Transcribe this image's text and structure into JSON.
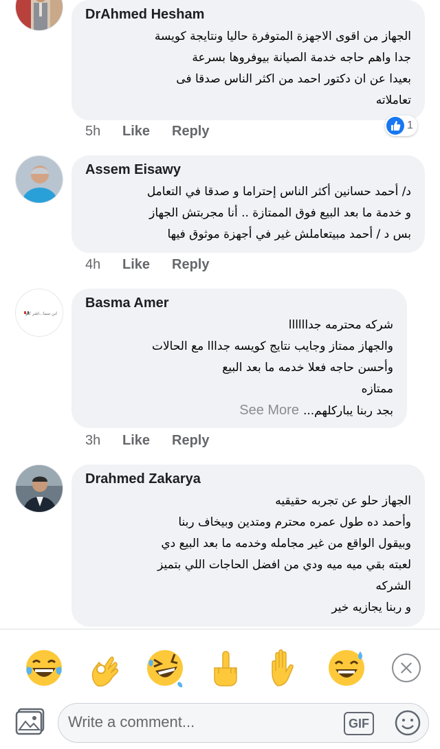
{
  "comments": [
    {
      "author": "DrAhmed Hesham",
      "lines": [
        "الجهاز من اقوى الاجهزة المتوفرة حاليا ونتايجة كويسة",
        "جدا  واهم حاجه خدمة الصيانة بيوفروها بسرعة",
        "بعيدا عن ان دكتور احمد من اكثر الناس  صدقا فى",
        "تعاملاته"
      ],
      "time": "5h",
      "like": "Like",
      "reply": "Reply",
      "reaction_count": "1"
    },
    {
      "author": "Assem Eisawy",
      "lines": [
        "د/ أحمد حسانين أكثر الناس إحتراما و صدقا في التعامل",
        "و خدمة ما بعد البيع فوق الممتازة .. أنا مجربتش الجهاز",
        "بس د / أحمد مبيتعاملش غير في أجهزة موثوق فيها"
      ],
      "time": "4h",
      "like": "Like",
      "reply": "Reply"
    },
    {
      "author": "Basma Amer",
      "lines": [
        "شركه محترمه جداااااا",
        "والجهاز ممتاز وجايب نتايج كويسه جدااا مع الحالات",
        "وأحسن حاجه فعلا خدمه ما بعد البيع",
        "ممتازه"
      ],
      "last_line": "بجد ربنا يباركلهم...",
      "see_more": "See More",
      "avatar_text": "ابن سينا...اشر كلو",
      "time": "3h",
      "like": "Like",
      "reply": "Reply"
    },
    {
      "author": "Drahmed Zakarya",
      "lines": [
        "الجهاز حلو عن تجربه حقيقيه",
        "وأحمد ده طول عمره محترم ومتدين وبيخاف ربنا",
        "وبيقول الواقع من غير مجامله وخدمه ما بعد البيع دي",
        "لعبته بقي ميه ميه ودي من افضل الحاجات اللي بتميز",
        "الشركه",
        "و ربنا يجازيه خير"
      ]
    }
  ],
  "reactions": [
    {
      "name": "laughing-tears-emoji-icon"
    },
    {
      "name": "ok-hand-emoji-icon"
    },
    {
      "name": "rolling-laughing-emoji-icon"
    },
    {
      "name": "middle-finger-emoji-icon"
    },
    {
      "name": "raised-hand-emoji-icon"
    },
    {
      "name": "sweat-smile-emoji-icon"
    }
  ],
  "composer": {
    "placeholder": "Write a comment...",
    "gif_label": "GIF"
  },
  "colors": {
    "bubble": "#f0f2f5",
    "like_blue": "#1877f2",
    "meta_gray": "#65676b",
    "emoji_yellow": "#fdc93a"
  }
}
